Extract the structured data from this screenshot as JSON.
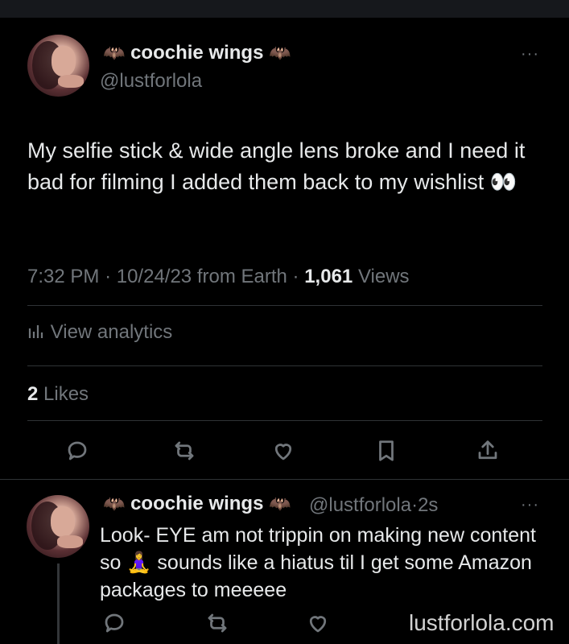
{
  "tweet": {
    "author_name": "coochie wings",
    "author_emoji": "🦇",
    "author_handle": "@lustforlola",
    "more_label": "···",
    "text": "My selfie stick & wide angle lens broke and I need it bad for filming I added them back to my wishlist 👀",
    "time": "7:32 PM",
    "date": "10/24/23",
    "source": "from Earth",
    "views_count": "1,061",
    "views_label": "Views",
    "analytics_label": "View analytics",
    "likes_count": "2",
    "likes_label": "Likes"
  },
  "reply": {
    "author_name": "coochie wings",
    "author_emoji": "🦇",
    "author_handle": "@lustforlola",
    "time_ago": "2s",
    "more_label": "···",
    "text": "Look- EYE am not trippin on making new content so 🧘‍♀️ sounds like a hiatus til I get some Amazon packages to meeeee"
  },
  "watermark": "lustforlola.com",
  "icons": [
    "reply-icon",
    "retweet-icon",
    "like-icon",
    "bookmark-icon",
    "share-icon",
    "analytics-icon"
  ]
}
